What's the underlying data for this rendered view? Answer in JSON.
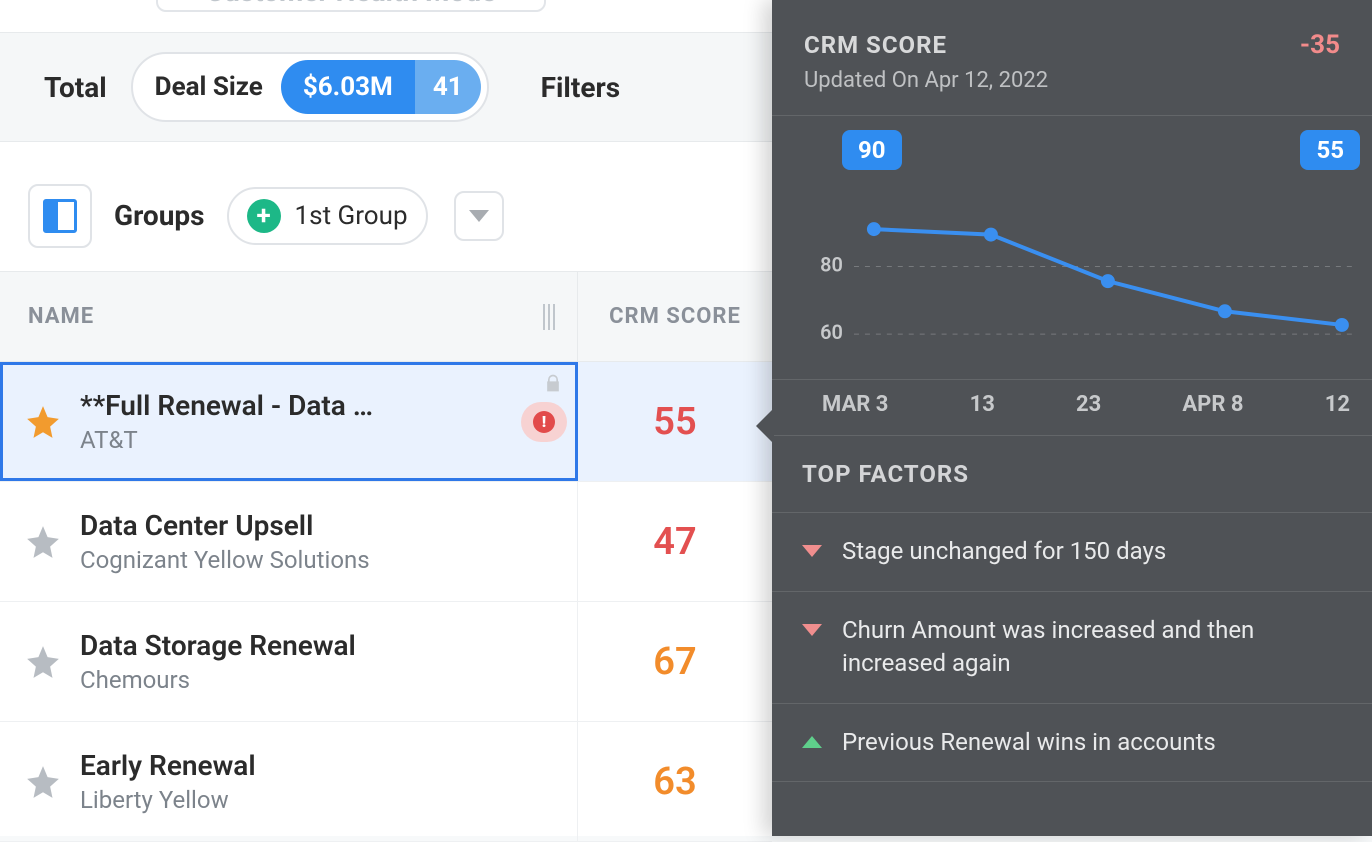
{
  "header": {
    "mode_label_truncated": "Customer Health Mode",
    "total_label": "Total",
    "deal_size_label": "Deal Size",
    "deal_size_value": "$6.03M",
    "deal_count": "41",
    "filters_label": "Filters"
  },
  "groups": {
    "label": "Groups",
    "first_group_label": "1st Group"
  },
  "columns": {
    "name": "NAME",
    "crm_score": "CRM SCORE"
  },
  "rows": [
    {
      "starred": true,
      "name": "**Full Renewal - Data …",
      "account": "AT&T",
      "score": 55,
      "score_class": "red",
      "alert": true,
      "locked": true,
      "selected": true
    },
    {
      "starred": false,
      "name": "Data Center Upsell",
      "account": "Cognizant Yellow Solutions",
      "score": 47,
      "score_class": "red"
    },
    {
      "starred": false,
      "name": "Data Storage Renewal",
      "account": "Chemours",
      "score": 67,
      "score_class": "orange"
    },
    {
      "starred": false,
      "name": "Early Renewal",
      "account": "Liberty Yellow",
      "score": 63,
      "score_class": "orange"
    }
  ],
  "popover": {
    "title": "CRM SCORE",
    "delta": "-35",
    "updated": "Updated On Apr 12, 2022",
    "badge_start": "90",
    "badge_end": "55",
    "yticks": [
      "80",
      "60"
    ],
    "xticks": [
      "MAR 3",
      "13",
      "23",
      "APR 8",
      "12"
    ],
    "factors_title": "TOP FACTORS",
    "factors": [
      {
        "dir": "down",
        "text": "Stage unchanged for 150 days"
      },
      {
        "dir": "down",
        "text": "Churn Amount was increased and then increased again"
      },
      {
        "dir": "up",
        "text": "Previous Renewal wins in accounts"
      }
    ]
  },
  "chart_data": {
    "type": "line",
    "title": "CRM SCORE",
    "x": [
      "Mar 3",
      "Mar 13",
      "Mar 23",
      "Apr 8",
      "Apr 12"
    ],
    "values": [
      90,
      88,
      71,
      60,
      55
    ],
    "ylim": [
      40,
      100
    ],
    "ylabel": "",
    "xlabel": ""
  }
}
